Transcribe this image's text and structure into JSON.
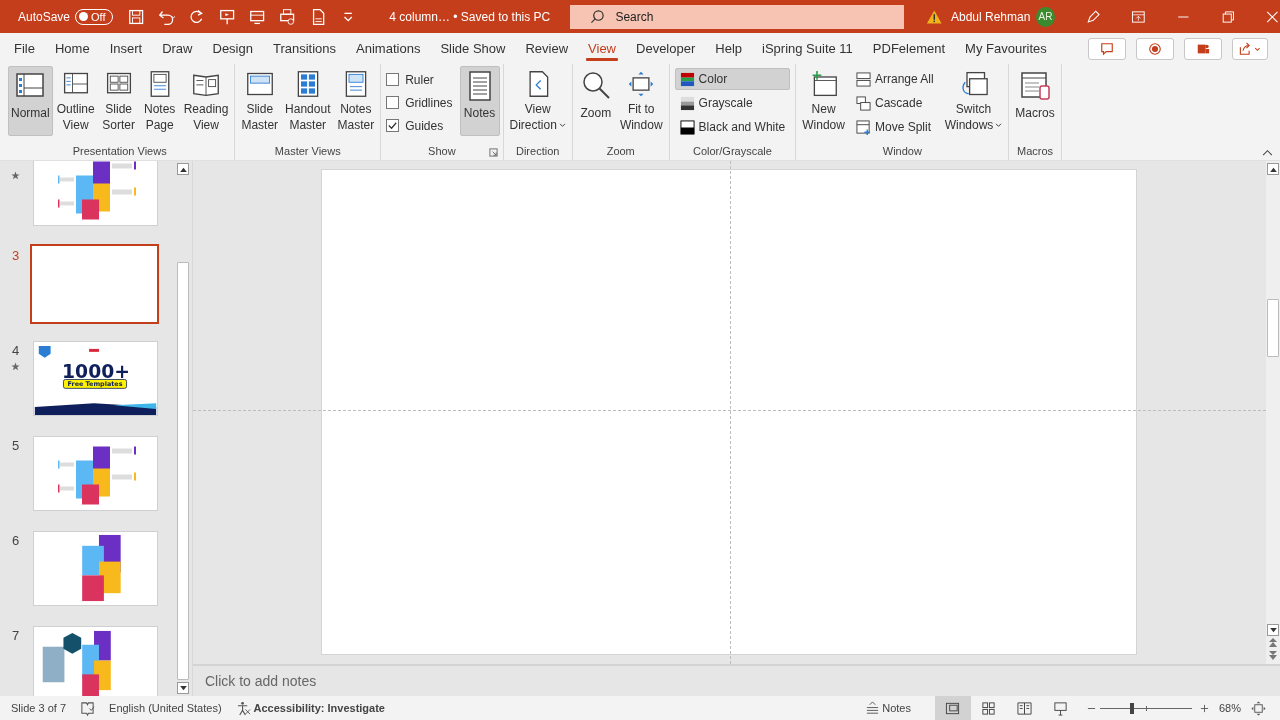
{
  "title_bar": {
    "autosave_label": "AutoSave",
    "autosave": {
      "on": false,
      "label": "Off"
    },
    "document_title": "4 column… • Saved to this PC",
    "search": {
      "placeholder": "Search"
    },
    "user_name": "Abdul Rehman",
    "user_initials": "AR"
  },
  "menu_tabs": [
    {
      "label": "File",
      "selected": false
    },
    {
      "label": "Home",
      "selected": false
    },
    {
      "label": "Insert",
      "selected": false
    },
    {
      "label": "Draw",
      "selected": false
    },
    {
      "label": "Design",
      "selected": false
    },
    {
      "label": "Transitions",
      "selected": false
    },
    {
      "label": "Animations",
      "selected": false
    },
    {
      "label": "Slide Show",
      "selected": false
    },
    {
      "label": "Review",
      "selected": false
    },
    {
      "label": "View",
      "selected": true
    },
    {
      "label": "Developer",
      "selected": false
    },
    {
      "label": "Help",
      "selected": false
    },
    {
      "label": "iSpring Suite 11",
      "selected": false
    },
    {
      "label": "PDFelement",
      "selected": false
    },
    {
      "label": "My Favourites",
      "selected": false
    }
  ],
  "ribbon": {
    "groups": [
      {
        "label": "Presentation Views",
        "items": [
          {
            "kind": "large",
            "lines": [
              "Normal"
            ],
            "selected": true
          },
          {
            "kind": "large",
            "lines": [
              "Outline",
              "View"
            ],
            "selected": false
          },
          {
            "kind": "large",
            "lines": [
              "Slide",
              "Sorter"
            ],
            "selected": false
          },
          {
            "kind": "large",
            "lines": [
              "Notes",
              "Page"
            ],
            "selected": false
          },
          {
            "kind": "large",
            "lines": [
              "Reading",
              "View"
            ],
            "selected": false
          }
        ]
      },
      {
        "label": "Master Views",
        "items": [
          {
            "kind": "large",
            "lines": [
              "Slide",
              "Master"
            ]
          },
          {
            "kind": "large",
            "lines": [
              "Handout",
              "Master"
            ]
          },
          {
            "kind": "large",
            "lines": [
              "Notes",
              "Master"
            ]
          }
        ]
      },
      {
        "label": "Show",
        "launcher": true,
        "items": [
          {
            "kind": "check",
            "lines": [
              "Ruler"
            ],
            "checked": false
          },
          {
            "kind": "check",
            "lines": [
              "Gridlines"
            ],
            "checked": false
          },
          {
            "kind": "check",
            "lines": [
              "Guides"
            ],
            "checked": true
          },
          {
            "kind": "large",
            "lines": [
              "Notes"
            ],
            "selected": true
          }
        ]
      },
      {
        "label": "Direction",
        "items": [
          {
            "kind": "large",
            "lines": [
              "View",
              "Direction"
            ],
            "dropdown": true
          }
        ]
      },
      {
        "label": "Zoom",
        "items": [
          {
            "kind": "large",
            "lines": [
              "Zoom"
            ]
          },
          {
            "kind": "large",
            "lines": [
              "Fit to",
              "Window"
            ]
          }
        ]
      },
      {
        "label": "Color/Grayscale",
        "items": [
          {
            "kind": "small",
            "lines": [
              "Color"
            ],
            "selected": true
          },
          {
            "kind": "small",
            "lines": [
              "Grayscale"
            ],
            "selected": false
          },
          {
            "kind": "small",
            "lines": [
              "Black and White"
            ],
            "selected": false
          }
        ]
      },
      {
        "label": "Window",
        "items": [
          {
            "kind": "large",
            "lines": [
              "New",
              "Window"
            ]
          },
          {
            "kind": "small",
            "lines": [
              "Arrange All"
            ]
          },
          {
            "kind": "small",
            "lines": [
              "Cascade"
            ]
          },
          {
            "kind": "small",
            "lines": [
              "Move Split"
            ]
          },
          {
            "kind": "large",
            "lines": [
              "Switch",
              "Windows"
            ],
            "dropdown": true
          }
        ]
      },
      {
        "label": "Macros",
        "items": [
          {
            "kind": "large",
            "lines": [
              "Macros"
            ]
          }
        ]
      }
    ]
  },
  "slides": [
    {
      "kind": "steps",
      "starred": true,
      "selected": false
    },
    {
      "number": "3",
      "kind": "blank",
      "starred": false,
      "selected": true
    },
    {
      "number": "4",
      "kind": "promo",
      "starred": true,
      "selected": false,
      "headline": "1000+",
      "badge": "Free Templates"
    },
    {
      "number": "5",
      "kind": "steps",
      "starred": false,
      "selected": false
    },
    {
      "number": "6",
      "kind": "blocks",
      "starred": false,
      "selected": false
    },
    {
      "number": "7",
      "kind": "hex",
      "starred": false,
      "selected": false
    }
  ],
  "notes": {
    "placeholder": "Click to add notes"
  },
  "status_bar": {
    "slide_count": "Slide 3 of 7",
    "language": "English (United States)",
    "accessibility": "Accessibility: Investigate",
    "notes_button": "Notes",
    "views": [
      {
        "selected": true
      },
      {
        "selected": false
      },
      {
        "selected": false
      },
      {
        "selected": false
      }
    ],
    "zoom": {
      "level": 0.35,
      "reading": "68%"
    }
  }
}
